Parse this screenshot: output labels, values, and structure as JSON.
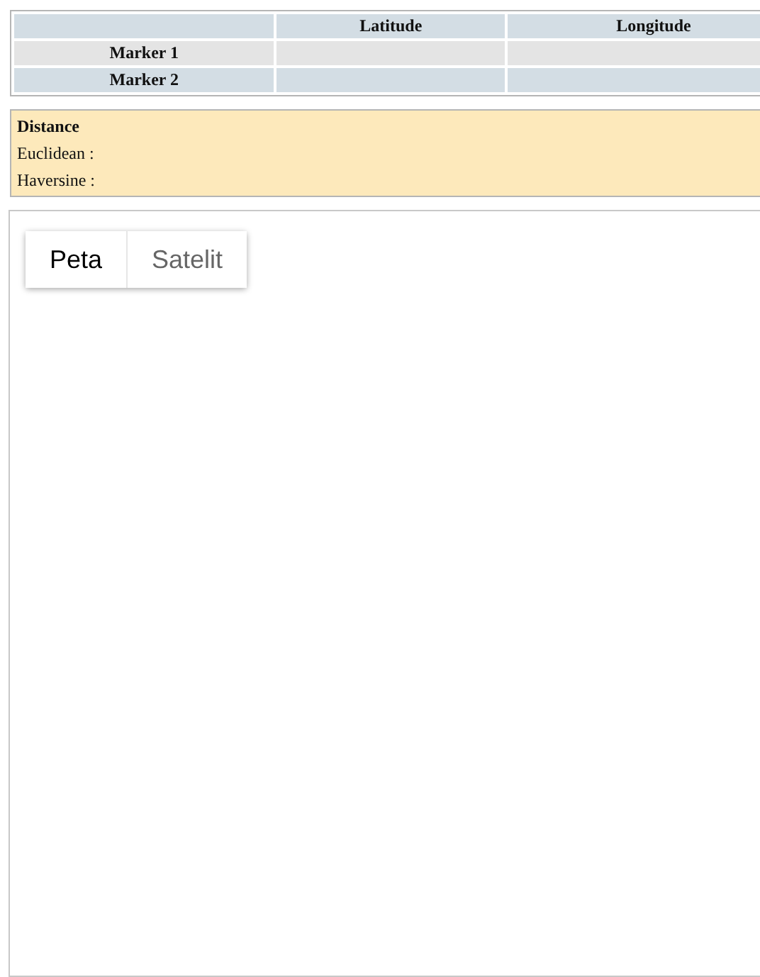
{
  "table": {
    "columns": [
      "",
      "Latitude",
      "Longitude"
    ],
    "rows": [
      {
        "label": "Marker 1"
      },
      {
        "label": "Marker 2"
      }
    ]
  },
  "distance": {
    "title": "Distance",
    "lines": [
      "Euclidean :",
      "Haversine :"
    ]
  },
  "map": {
    "map_types": [
      {
        "label": "Peta",
        "selected": true
      },
      {
        "label": "Satelit",
        "selected": false
      }
    ]
  }
}
